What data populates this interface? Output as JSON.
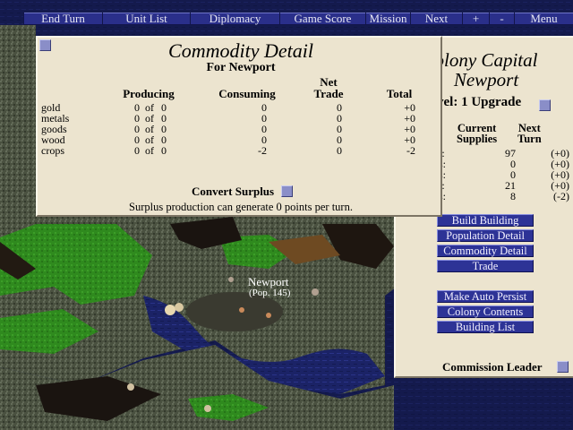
{
  "menu": {
    "items": [
      {
        "key": "end_turn",
        "label": "End Turn"
      },
      {
        "key": "unit_list",
        "label": "Unit List"
      },
      {
        "key": "diplomacy",
        "label": "Diplomacy"
      },
      {
        "key": "game_score",
        "label": "Game Score"
      },
      {
        "key": "mission",
        "label": "Mission"
      },
      {
        "key": "next",
        "label": "Next"
      },
      {
        "key": "plus",
        "label": "+"
      },
      {
        "key": "minus",
        "label": "-"
      },
      {
        "key": "menu",
        "label": "Menu"
      }
    ]
  },
  "commodity": {
    "title": "Commodity Detail",
    "subtitle": "For Newport",
    "headers": {
      "producing": "Producing",
      "consuming": "Consuming",
      "net": "Net",
      "trade": "Trade",
      "total": "Total"
    },
    "of_word": "of",
    "rows": [
      {
        "name": "gold",
        "produced": "0",
        "capacity": "0",
        "consuming": "0",
        "trade": "0",
        "total": "+0"
      },
      {
        "name": "metals",
        "produced": "0",
        "capacity": "0",
        "consuming": "0",
        "trade": "0",
        "total": "+0"
      },
      {
        "name": "goods",
        "produced": "0",
        "capacity": "0",
        "consuming": "0",
        "trade": "0",
        "total": "+0"
      },
      {
        "name": "wood",
        "produced": "0",
        "capacity": "0",
        "consuming": "0",
        "trade": "0",
        "total": "+0"
      },
      {
        "name": "crops",
        "produced": "0",
        "capacity": "0",
        "consuming": "-2",
        "trade": "0",
        "total": "-2"
      }
    ],
    "convert_surplus_label": "Convert Surplus",
    "surplus_note": "Surplus production can generate 0 points per turn."
  },
  "colony": {
    "title_line1": "olony Capital",
    "title_line2": "Newport",
    "level_text": "vel: 1",
    "upgrade_label": "Upgrade",
    "current_header_1": "Current",
    "current_header_2": "Supplies",
    "next_header_1": "Next",
    "next_header_2": "Turn",
    "supplies": [
      {
        "label": "l:",
        "current": "97",
        "next": "(+0)"
      },
      {
        "label": "s:",
        "current": "0",
        "next": "(+0)"
      },
      {
        "label": "s:",
        "current": "0",
        "next": "(+0)"
      },
      {
        "label": "l:",
        "current": "21",
        "next": "(+0)"
      },
      {
        "label": "s:",
        "current": "8",
        "next": "(-2)"
      }
    ],
    "buttons": [
      {
        "key": "build_building",
        "label": "Build Building"
      },
      {
        "key": "population_detail",
        "label": "Population Detail"
      },
      {
        "key": "commodity_detail",
        "label": "Commodity Detail"
      },
      {
        "key": "trade",
        "label": "Trade"
      },
      {
        "key": "make_auto_persist",
        "label": "Make Auto Persist"
      },
      {
        "key": "colony_contents",
        "label": "Colony Contents"
      },
      {
        "key": "building_list",
        "label": "Building List"
      }
    ],
    "commission_label": "Commission Leader"
  },
  "map": {
    "city_name": "Newport",
    "city_pop": "(Pop. 145)"
  },
  "colors": {
    "panel_bg": "#ece4cf",
    "button_bg": "#2d3396",
    "ocean": "#10163a",
    "land": "#3f4a3a",
    "grass": "#2f8a1e"
  }
}
